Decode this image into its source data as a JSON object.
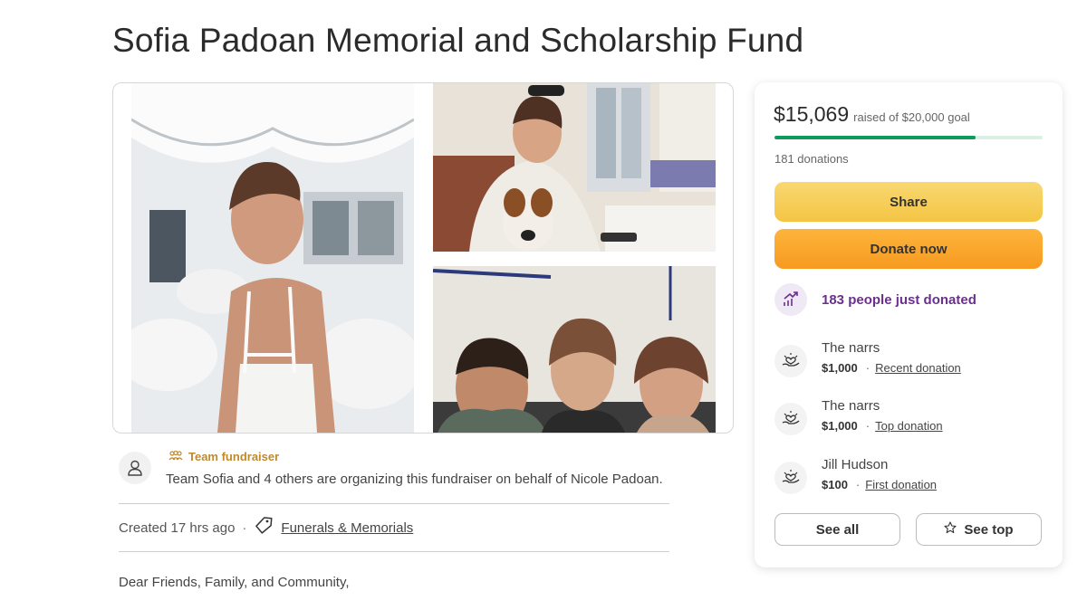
{
  "page": {
    "title": "Sofia Padoan Memorial and Scholarship Fund"
  },
  "organizer": {
    "tag": "Team fundraiser",
    "text": "Team Sofia and 4 others are organizing this fundraiser on behalf of Nicole Padoan."
  },
  "meta": {
    "created": "Created 17 hrs ago",
    "separator": "·",
    "category": "Funerals & Memorials"
  },
  "story": {
    "opening": "Dear Friends, Family, and Community,"
  },
  "donation_card": {
    "raised": "$15,069",
    "goal_text": "raised of $20,000 goal",
    "progress_fraction": 0.75,
    "donations": "181 donations",
    "share_label": "Share",
    "donate_label": "Donate now",
    "trending": "183 people just donated",
    "donors": [
      {
        "name": "The narrs",
        "amount": "$1,000",
        "type": "Recent donation"
      },
      {
        "name": "The narrs",
        "amount": "$1,000",
        "type": "Top donation"
      },
      {
        "name": "Jill Hudson",
        "amount": "$100",
        "type": "First donation"
      }
    ],
    "see_all_label": "See all",
    "see_top_label": "See top"
  },
  "icons": {
    "organizer": "user-icon",
    "team": "team-icon",
    "category": "tag-icon",
    "trending": "trending-icon",
    "donor": "heart-hand-icon",
    "see_top": "star-icon"
  },
  "colors": {
    "progress": "#0d9a5a",
    "share_button": "#f4c543",
    "donate_button": "#f79a20",
    "trending_text": "#6b2f8d",
    "team_tag": "#c08a2c"
  }
}
